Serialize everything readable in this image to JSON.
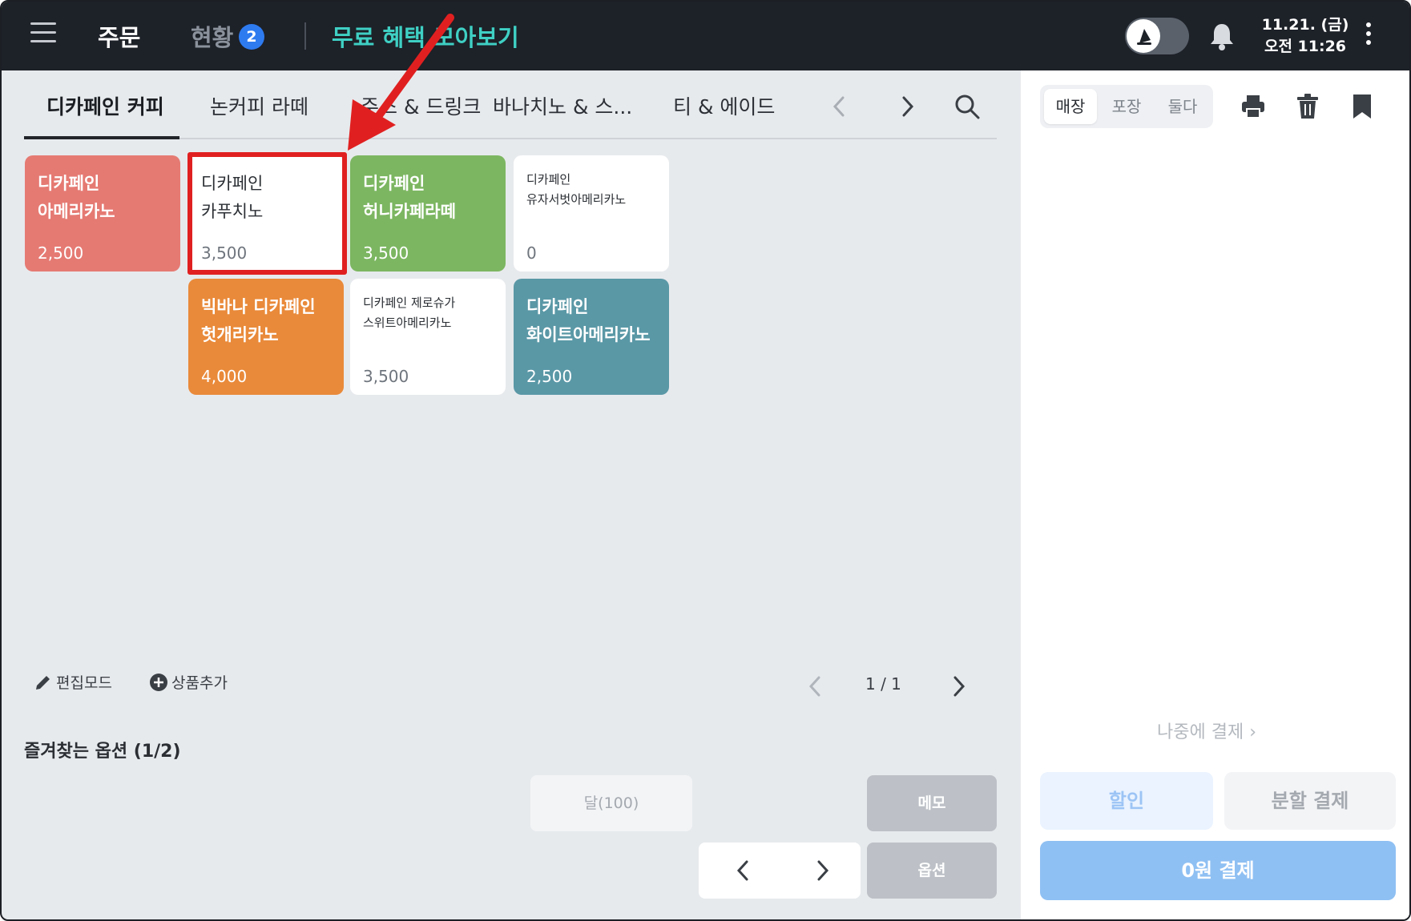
{
  "header": {
    "tab_order": "주문",
    "tab_status": "현황",
    "status_count": "2",
    "promo_link": "무료 혜택 모아보기",
    "date": "11.21. (금)",
    "time": "오전 11:26"
  },
  "categories": [
    {
      "label": "디카페인 커피",
      "active": true
    },
    {
      "label": "논커피 라떼",
      "active": false
    },
    {
      "label": "주스 & 드링크",
      "active": false
    },
    {
      "label": "바나치노 & 스...",
      "active": false
    },
    {
      "label": "티 & 에이드",
      "active": false
    }
  ],
  "products": [
    {
      "name": "디카페인\n아메리카노",
      "price": "2,500",
      "color": "#e57a73"
    },
    {
      "name": "디카페인\n카푸치노",
      "price": "3,500",
      "color": "#ffffff"
    },
    {
      "name": "디카페인\n허니카페라떼",
      "price": "3,500",
      "color": "#7cb661"
    },
    {
      "name": "디카페인\n유자서벗아메리카노",
      "price": "0",
      "color": "#ffffff"
    },
    {
      "name": "빅바나 디카페인\n헛개리카노",
      "price": "4,000",
      "color": "#e98a3a"
    },
    {
      "name": "디카페인 제로슈가\n스위트아메리카노",
      "price": "3,500",
      "color": "#ffffff"
    },
    {
      "name": "디카페인\n화이트아메리카노",
      "price": "2,500",
      "color": "#5a98a6"
    }
  ],
  "tools": {
    "edit_mode": "편집모드",
    "add_product": "상품추가",
    "page": "1 / 1"
  },
  "favorites": {
    "title": "즐겨찾는 옵션 (1/2)",
    "sugar": "달(100)",
    "memo": "메모",
    "option": "옵션"
  },
  "order_panel": {
    "seg_store": "매장",
    "seg_takeout": "포장",
    "seg_both": "둘다",
    "pay_later": "나중에 결제",
    "discount": "할인",
    "split_pay": "분할 결제",
    "pay": "0원 결제"
  },
  "colors": {
    "header_bg": "#1d2128",
    "promo": "#3fd0c4",
    "badge": "#2e7bf0",
    "annotation": "#e02020",
    "pay_button": "#8fc0f3"
  }
}
